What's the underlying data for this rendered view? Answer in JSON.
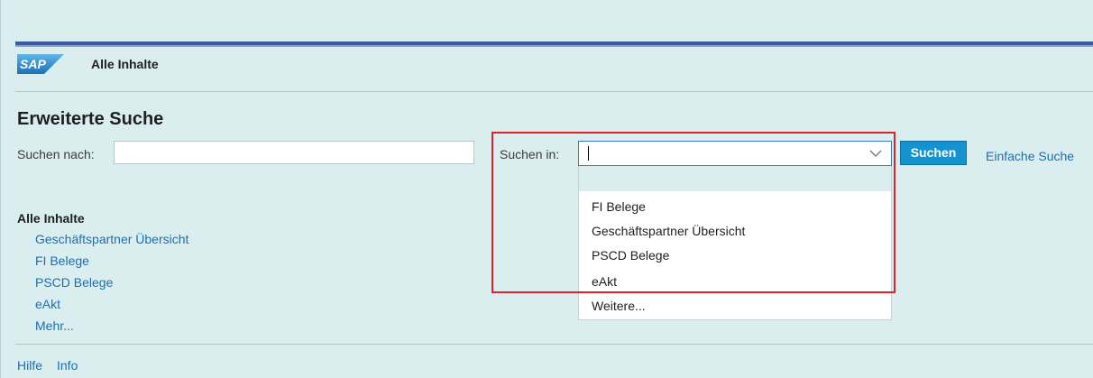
{
  "header": {
    "logo_text": "SAP",
    "app_title": "Alle Inhalte"
  },
  "search": {
    "section_title": "Erweiterte Suche",
    "search_for_label": "Suchen nach:",
    "search_for_value": "",
    "search_in_label": "Suchen in:",
    "search_in_value": "",
    "search_button_label": "Suchen",
    "simple_search_link": "Einfache Suche"
  },
  "dropdown": {
    "options": [
      "",
      "FI Belege",
      "Geschäftspartner Übersicht",
      "PSCD Belege",
      "eAkt",
      "Weitere..."
    ]
  },
  "tree": {
    "title": "Alle Inhalte",
    "items": [
      "Geschäftspartner Übersicht",
      "FI Belege",
      "PSCD Belege",
      "eAkt",
      "Mehr..."
    ]
  },
  "footer": {
    "help": "Hilfe",
    "info": "Info"
  },
  "colors": {
    "accent_blue": "#1593d0",
    "link_blue": "#1a6fb3",
    "highlight_red": "#e0202a",
    "header_bar": "#3a5aa6",
    "background": "#daeef0"
  },
  "icons": {
    "logo": "sap-logo",
    "combo_arrow": "chevron-down-icon"
  }
}
